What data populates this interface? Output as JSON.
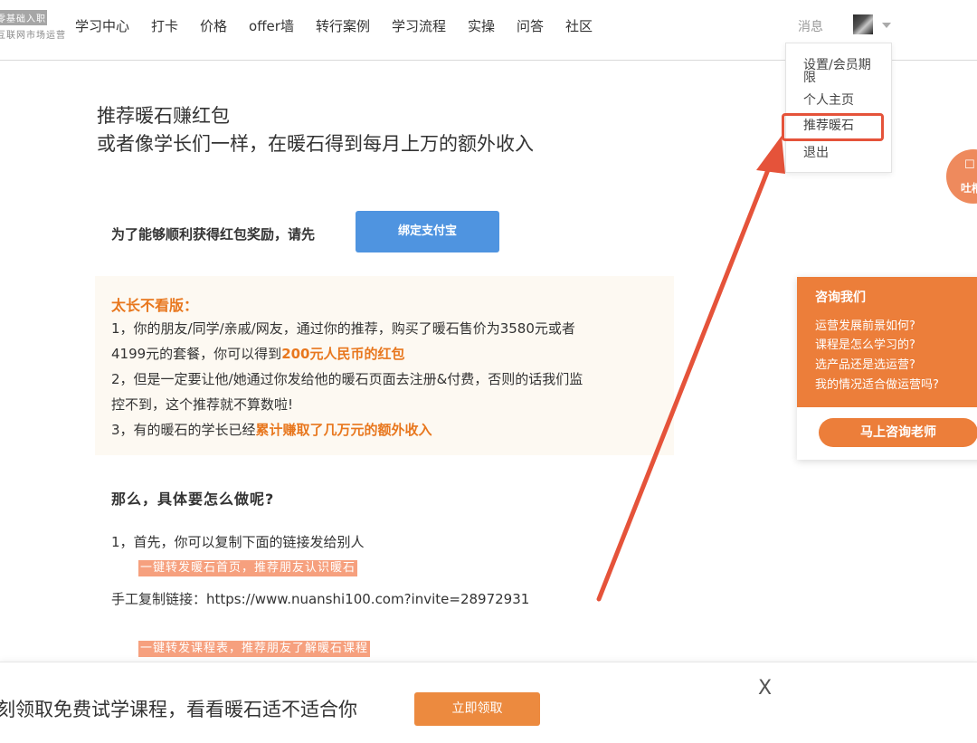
{
  "header": {
    "logo": {
      "top": "零基础入职",
      "bottom": "互联网市场运营"
    },
    "nav": [
      "学习中心",
      "打卡",
      "价格",
      "offer墙",
      "转行案例",
      "学习流程",
      "实操",
      "问答",
      "社区"
    ],
    "messages_label": "消息",
    "avatar_icon": "user-avatar",
    "caret_icon": "caret-down-icon"
  },
  "dropdown": {
    "items": [
      "设置/会员期限",
      "个人主页",
      "推荐暖石",
      "退出"
    ],
    "highlighted": "推荐暖石"
  },
  "feedback": {
    "icon": "chat-icon",
    "label": "吐槽"
  },
  "consult": {
    "title": "咨询我们",
    "questions": [
      "运营发展前景如何?",
      "课程是怎么学习的?",
      "选产品还是选运营?",
      "我的情况适合做运营吗?"
    ],
    "button": "马上咨询老师",
    "accent": "#ec7e3a"
  },
  "main": {
    "headline_1": "推荐暖石赚红包",
    "headline_2": "或者像学长们一样，在暖石得到每月上万的额外收入",
    "bind_prompt": "为了能够顺利获得红包奖励，请先",
    "bind_button": "绑定支付宝",
    "tldr": {
      "title": "太长不看版：",
      "line1": "1，你的朋友/同学/亲戚/网友，通过你的推荐，购买了暖石售价为3580元或者",
      "line2_pre": "4199元的套餐，你可以得到",
      "line2_hl": "200元人民币的红包",
      "line3": "2，但是一定要让他/她通过你发给他的暖石页面去注册&付费，否则的话我们监",
      "line4": "控不到，这个推荐就不算数啦!",
      "line5_pre": "3，有的暖石的学长已经",
      "line5_hl": "累计赚取了几万元的额外收入"
    },
    "how_title": "那么，具体要怎么做呢?",
    "step1": "1，首先，你可以复制下面的链接发给别人",
    "share_home": "一键转发暖石首页，推荐朋友认识暖石",
    "manual_link": "手工复制链接：https://www.nuanshi100.com?invite=28972931",
    "share_courses": "一键转发课程表，推荐朋友了解暖石课程"
  },
  "bottom_bar": {
    "text": "刻领取免费试学课程，看看暖石适不适合你",
    "button": "立即领取",
    "close": "X"
  },
  "colors": {
    "orange": "#e8771e",
    "blue": "#4f94e0",
    "annotation_red": "#e5533a"
  }
}
